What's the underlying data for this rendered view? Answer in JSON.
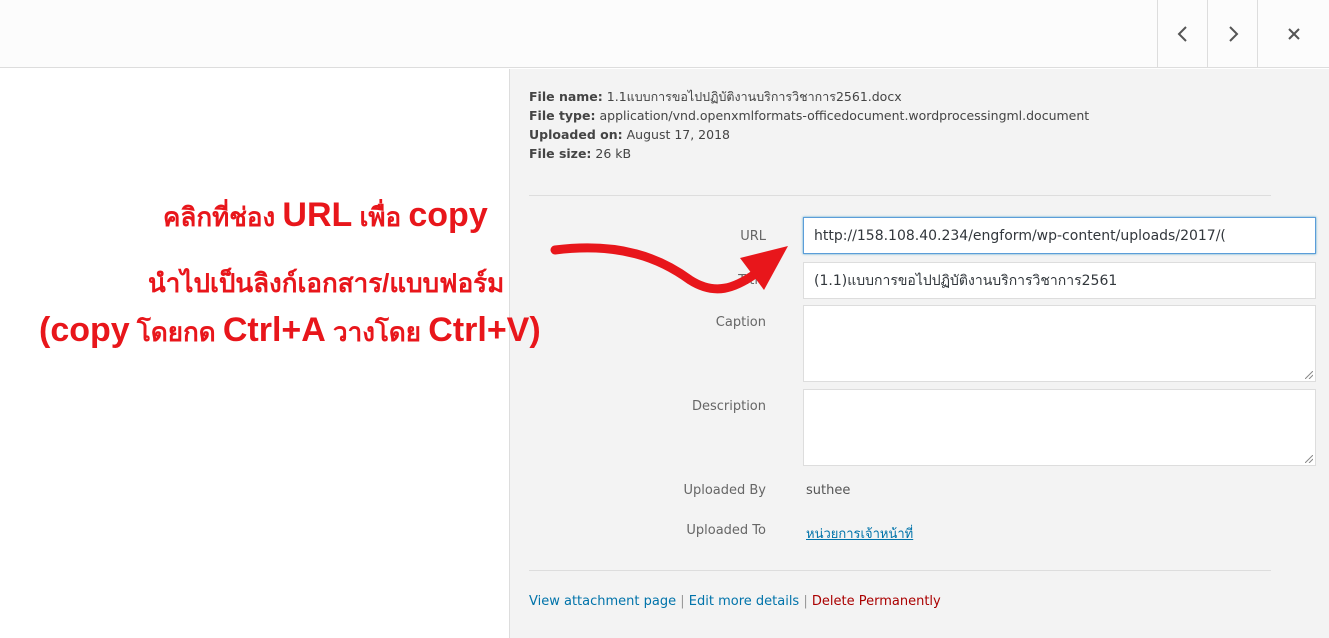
{
  "toolbar": {
    "prev_icon": "chevron-left-icon",
    "next_icon": "chevron-right-icon",
    "close_icon": "close-icon"
  },
  "file_details": {
    "name_label": "File name:",
    "name_value": "1.1แบบการขอไปปฏิบัติงานบริการวิชาการ2561.docx",
    "type_label": "File type:",
    "type_value": "application/vnd.openxmlformats-officedocument.wordprocessingml.document",
    "uploaded_label": "Uploaded on:",
    "uploaded_value": "August 17, 2018",
    "size_label": "File size:",
    "size_value": "26 kB"
  },
  "fields": {
    "url_label": "URL",
    "url_value": "http://158.108.40.234/engform/wp-content/uploads/2017/(",
    "title_label": "Title",
    "title_value": "(1.1)แบบการขอไปปฏิบัติงานบริการวิชาการ2561",
    "caption_label": "Caption",
    "description_label": "Description",
    "uploaded_by_label": "Uploaded By",
    "uploaded_by_value": "suthee",
    "uploaded_to_label": "Uploaded To",
    "uploaded_to_value": "หน่วยการเจ้าหน้าที่"
  },
  "actions": {
    "view_attachment": "View attachment page",
    "edit_details": "Edit more details",
    "delete": "Delete Permanently",
    "separator": "|"
  },
  "annotation": {
    "line1_a": "คลิกที่ช่อง ",
    "line1_b": "URL",
    "line1_c": " เพื่อ ",
    "line1_d": "copy",
    "line2": "นำไปเป็นลิงก์เอกสาร/แบบฟอร์ม",
    "line3_a": "(copy",
    "line3_b": " โดยกด ",
    "line3_c": "Ctrl+A",
    "line3_d": "  วางโดย ",
    "line3_e": "Ctrl+V)",
    "color": "#e8161b"
  },
  "colors": {
    "link": "#0073aa",
    "danger": "#a00000",
    "sidebar_bg": "#f3f3f3",
    "focus_border": "#5b9dd9"
  }
}
